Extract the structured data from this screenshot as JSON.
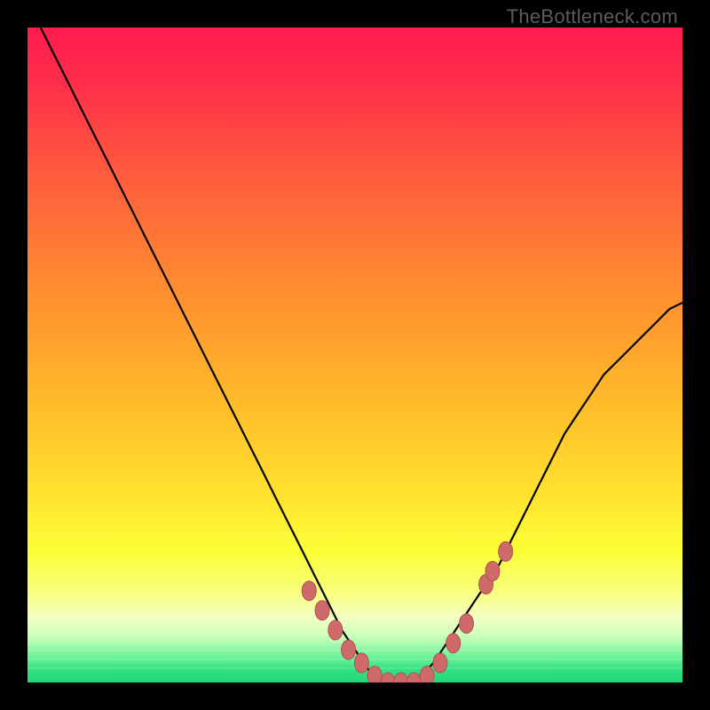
{
  "watermark": "TheBottleneck.com",
  "colors": {
    "black": "#000000",
    "red_top": "#ff1f4f",
    "orange_mid": "#ffa128",
    "yellow": "#fbff36",
    "pale_yellow": "#f7ffb0",
    "green_band": "#2fe37a",
    "curve": "#000000",
    "marker_fill": "#cf6a6a",
    "marker_stroke": "#b44f4f"
  },
  "chart_data": {
    "type": "line",
    "title": "",
    "xlabel": "",
    "ylabel": "",
    "xlim": [
      0,
      100
    ],
    "ylim": [
      0,
      100
    ],
    "x": [
      2,
      4,
      6,
      8,
      10,
      12,
      14,
      16,
      18,
      20,
      22,
      24,
      26,
      28,
      30,
      32,
      34,
      36,
      38,
      40,
      42,
      44,
      46,
      48,
      50,
      52,
      54,
      56,
      58,
      60,
      62,
      64,
      66,
      68,
      70,
      72,
      74,
      76,
      78,
      80,
      82,
      84,
      86,
      88,
      90,
      92,
      94,
      96,
      98,
      100
    ],
    "values": [
      100,
      96,
      92,
      88,
      84,
      80,
      76,
      72,
      68,
      64,
      60,
      56,
      52,
      48,
      44,
      40,
      36,
      32,
      28,
      24,
      20,
      16,
      12,
      8,
      5,
      2,
      0,
      0,
      0,
      1,
      3,
      6,
      9,
      12,
      15,
      18,
      22,
      26,
      30,
      34,
      38,
      41,
      44,
      47,
      49,
      51,
      53,
      55,
      57,
      58
    ],
    "markers_x": [
      43,
      45,
      47,
      49,
      51,
      53,
      55,
      57,
      59,
      61,
      63,
      65,
      67,
      70,
      71,
      73
    ],
    "markers_y": [
      14,
      11,
      8,
      5,
      3,
      1,
      0,
      0,
      0,
      1,
      3,
      6,
      9,
      15,
      17,
      20
    ]
  }
}
